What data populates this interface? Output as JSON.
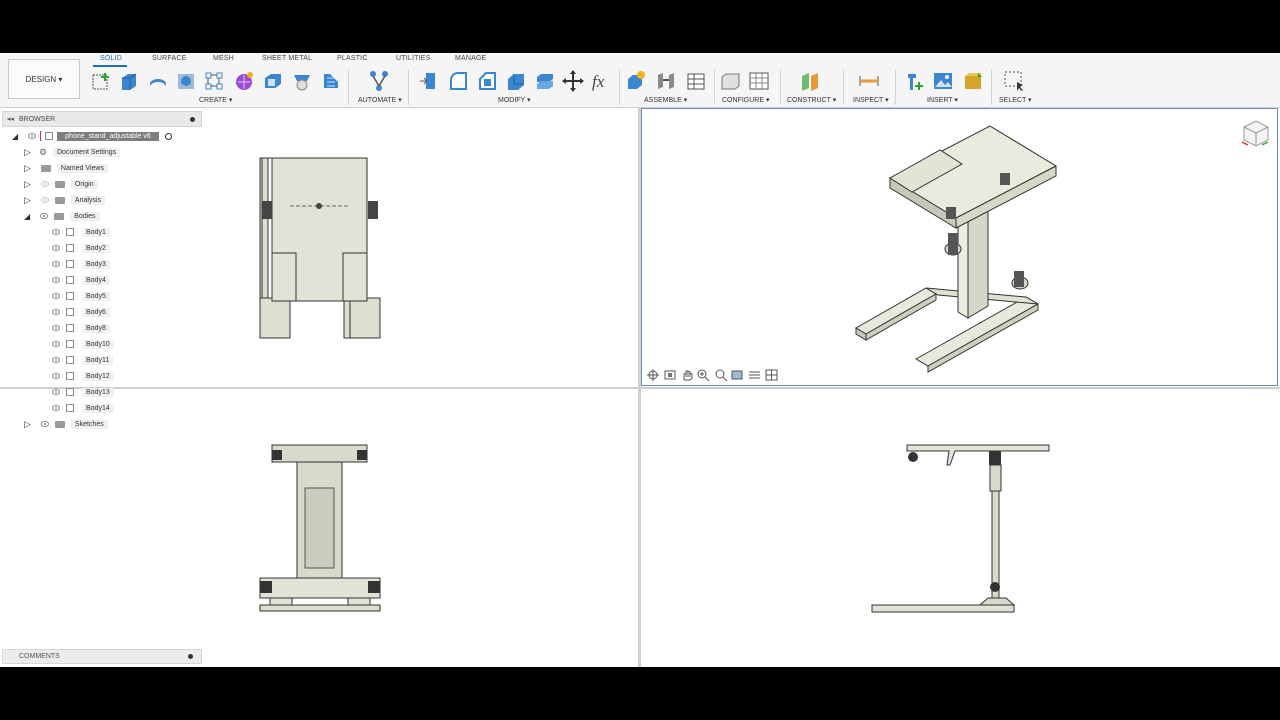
{
  "toolbar": {
    "design_label": "DESIGN ▾",
    "tabs": [
      "SOLID",
      "SURFACE",
      "MESH",
      "SHEET METAL",
      "PLASTIC",
      "UTILITIES",
      "MANAGE"
    ],
    "groups": {
      "create": "CREATE ▾",
      "automate": "AUTOMATE ▾",
      "modify": "MODIFY ▾",
      "assemble": "ASSEMBLE ▾",
      "configure": "CONFIGURE ▾",
      "construct": "CONSTRUCT ▾",
      "inspect": "INSPECT ▾",
      "insert": "INSERT ▾",
      "select": "SELECT ▾"
    },
    "accent_color": "#1e6fb5"
  },
  "browser": {
    "title": "BROWSER",
    "root": "phone_stand_adjustable v6",
    "items": {
      "doc_settings": "Document Settings",
      "named_views": "Named Views",
      "origin": "Origin",
      "analysis": "Analysis",
      "bodies": "Bodies",
      "sketches": "Sketches"
    },
    "bodies": [
      "Body1",
      "Body2",
      "Body3",
      "Body4",
      "Body5",
      "Body6",
      "Body8",
      "Body10",
      "Body11",
      "Body12",
      "Body13",
      "Body14"
    ]
  },
  "comments": {
    "label": "COMMENTS"
  }
}
